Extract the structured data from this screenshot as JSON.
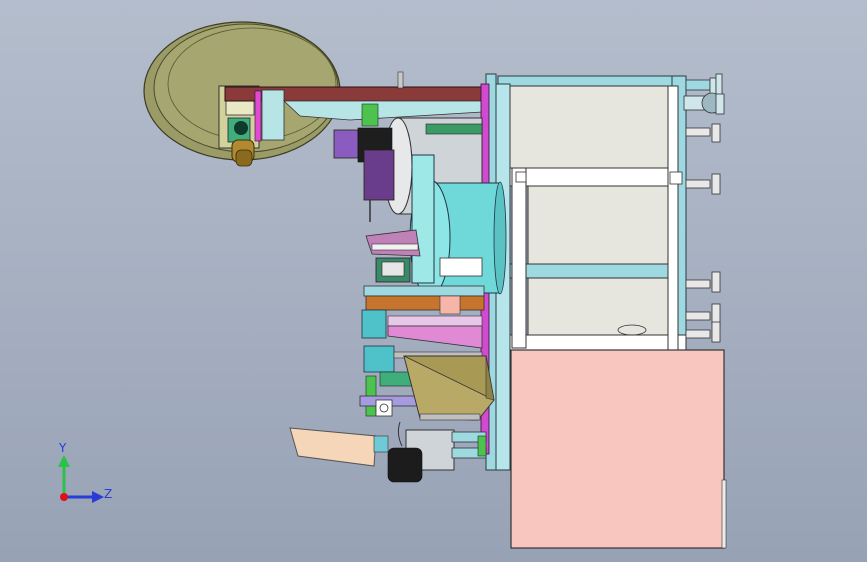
{
  "triad": {
    "y_label": "Y",
    "z_label": "Z",
    "colors": {
      "y_axis": "#2ac24a",
      "z_axis": "#2a3bd6",
      "x_axis": "#e0101a"
    }
  },
  "colors": {
    "background": "#a6b0c1",
    "reel_disc": "#9a9b66",
    "frame": "#9ed9e2",
    "panel": "#e6e6df",
    "cabinet": "#f9c6bf",
    "roller": "#6fd8d8",
    "bracket": "#8b3a3a",
    "chute": "#a89a55",
    "feed_plate": "#f5d6b8",
    "motor": "#8a5cc0"
  }
}
